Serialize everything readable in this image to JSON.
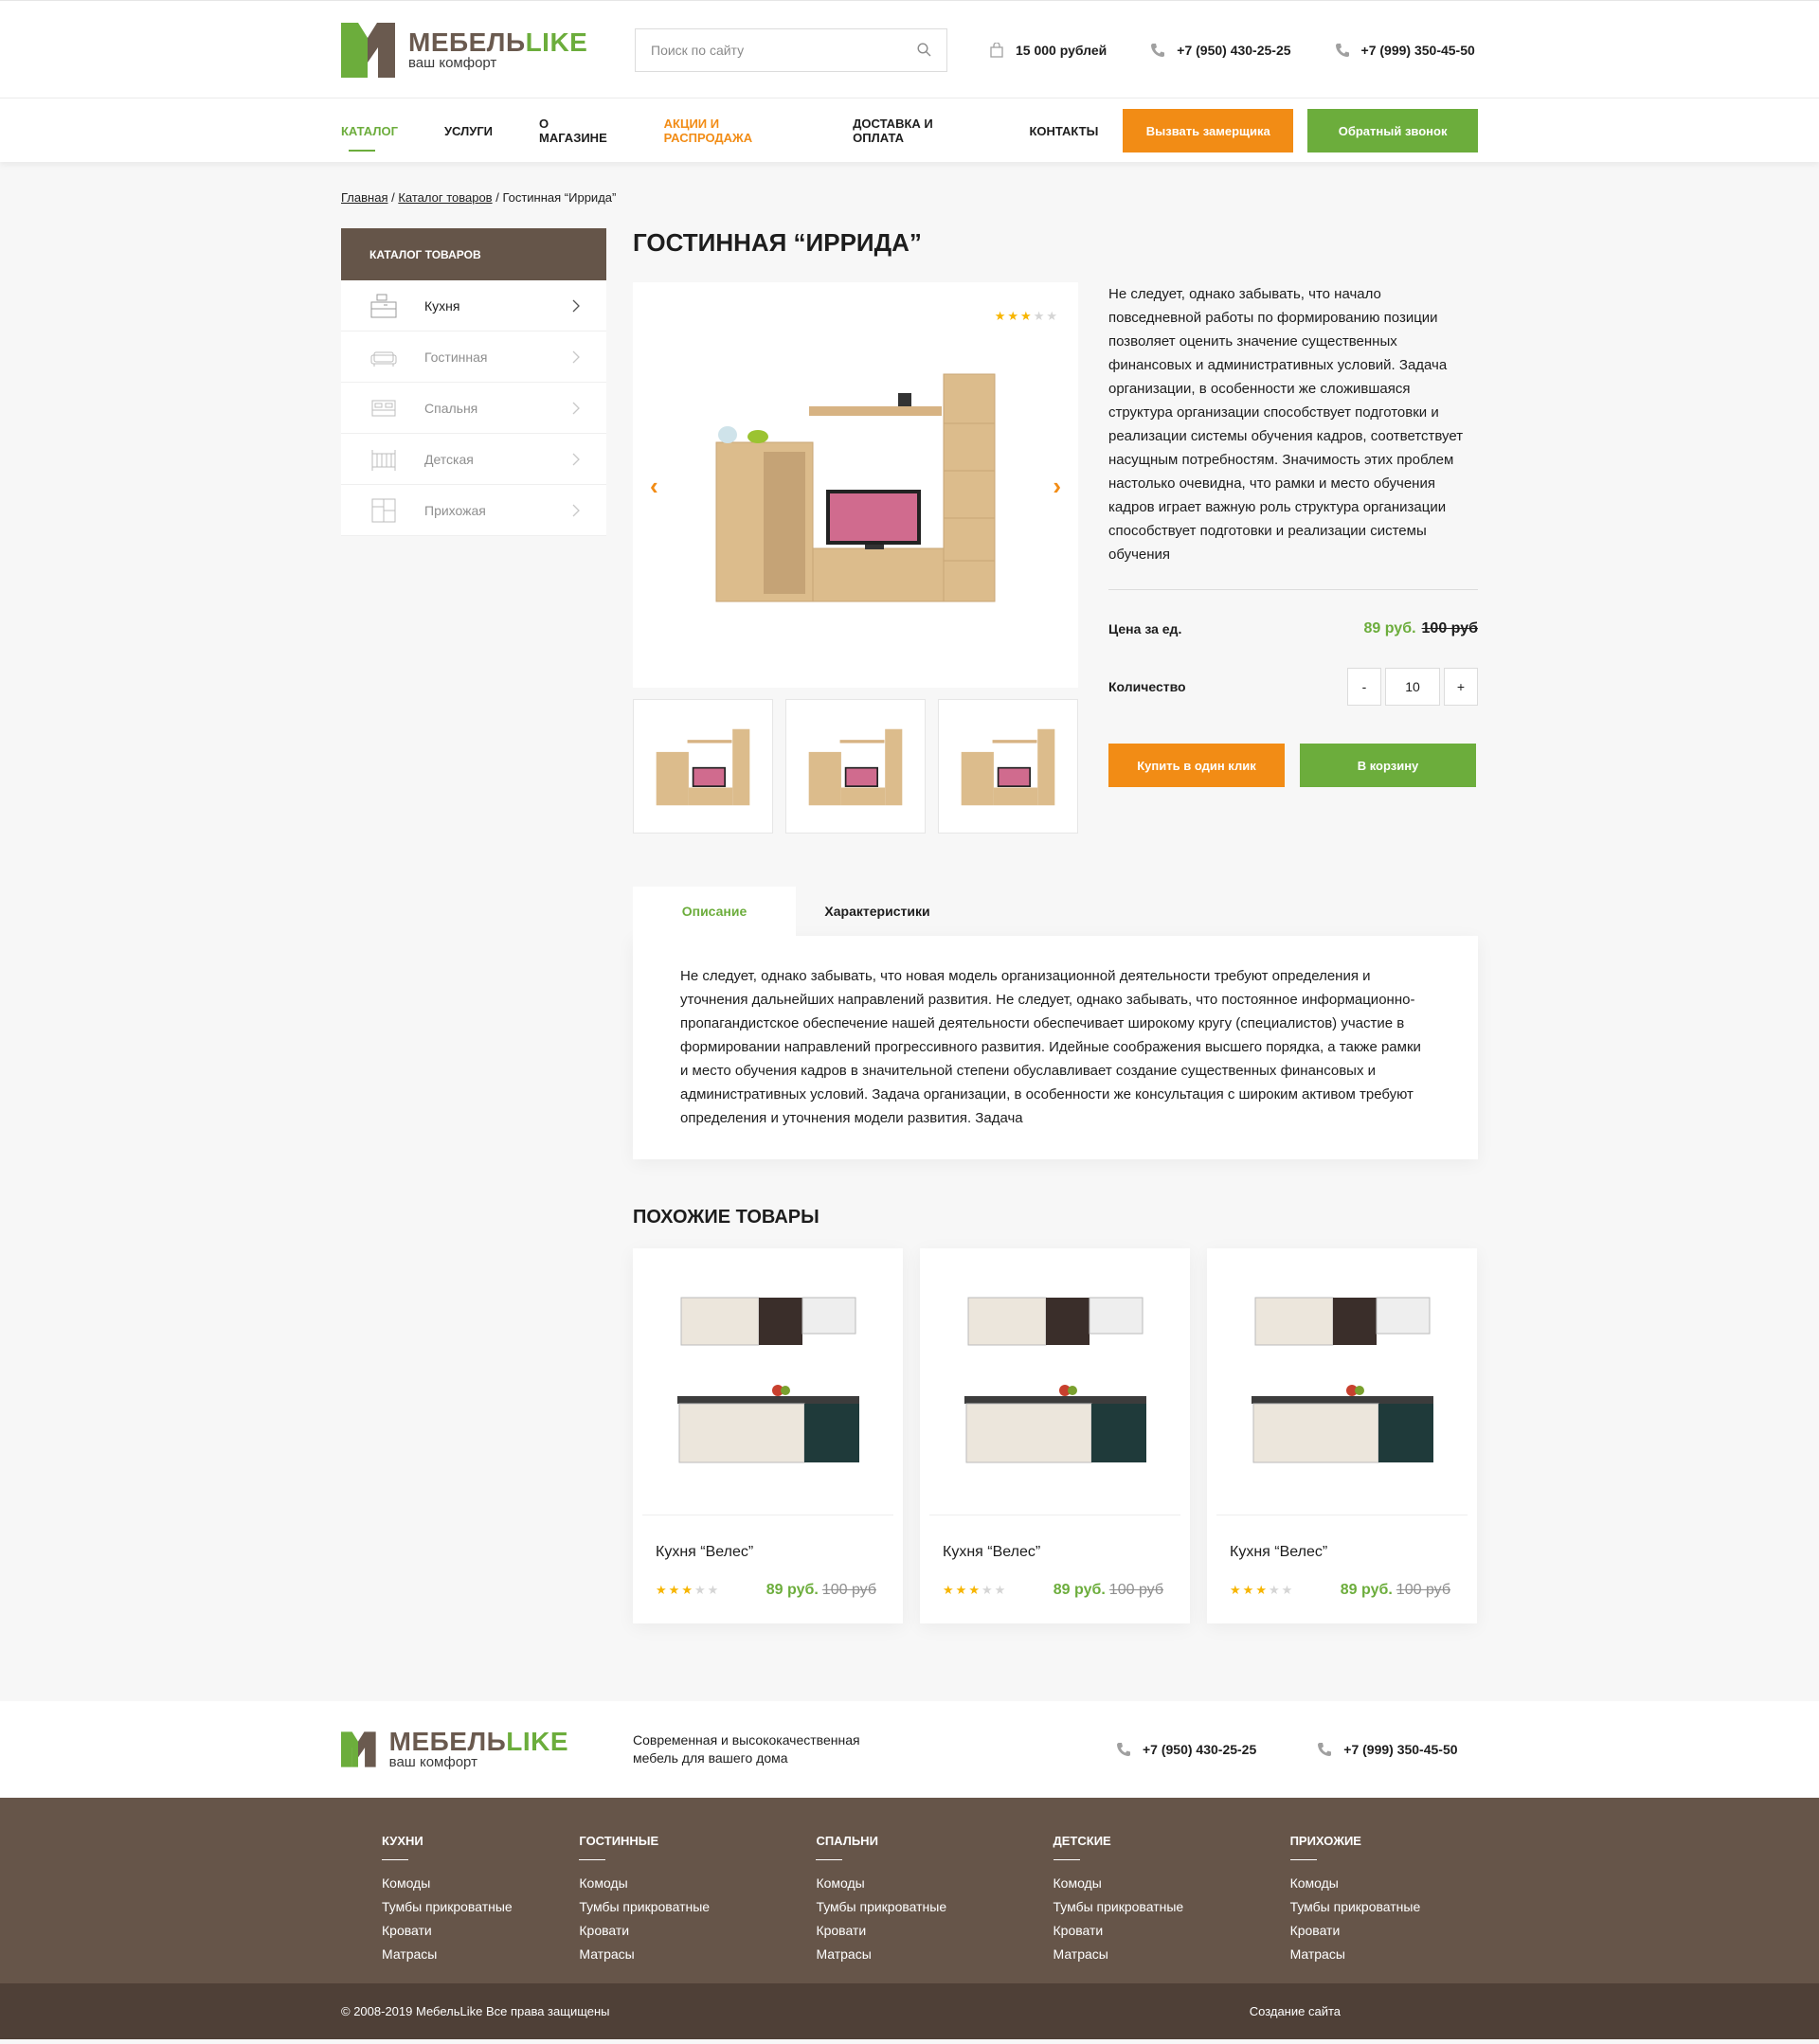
{
  "header": {
    "logo_name": "МЕБЕЛЬ",
    "logo_like": "LIKE",
    "logo_sub": "ваш комфорт",
    "search_placeholder": "Поиск по сайту",
    "cart_total": "15 000 рублей",
    "phone1": "+7 (950) 430-25-25",
    "phone2": "+7 (999) 350-45-50"
  },
  "nav": {
    "items": [
      "КАТАЛОГ",
      "УСЛУГИ",
      "О МАГАЗИНЕ",
      "АКЦИИ И РАСПРОДАЖА",
      "ДОСТАВКА И ОПЛАТА",
      "КОНТАКТЫ"
    ],
    "btn_measure": "Вызвать замерщика",
    "btn_callback": "Обратный звонок"
  },
  "breadcrumbs": {
    "home": "Главная",
    "sep": " / ",
    "catalog": "Каталог товаров",
    "current": "Гостинная “Иррида”"
  },
  "sidebar": {
    "title": "КАТАЛОГ ТОВАРОВ",
    "items": [
      "Кухня",
      "Гостинная",
      "Спальня",
      "Детская",
      "Прихожая"
    ]
  },
  "product": {
    "title": "ГОСТИННАЯ “ИРРИДА”",
    "rating": 3,
    "description": "Не следует, однако забывать, что начало повседневной работы по формированию позиции позволяет оценить значение существенных финансовых и административных условий. Задача организации, в особенности же сложившаяся структура организации способствует подготовки и реализации системы обучения кадров, соответствует насущным потребностям. Значимость этих проблем настолько очевидна, что рамки и место обучения кадров играет важную роль структура организации способствует подготовки и реализации системы обучения",
    "price_label": "Цена за ед.",
    "price_new": "89 руб.",
    "price_old": "100 руб",
    "qty_label": "Количество",
    "qty_minus": "-",
    "qty_value": "10",
    "qty_plus": "+",
    "btn_oneclick": "Купить в один клик",
    "btn_cart": "В корзину"
  },
  "tabs": {
    "items": [
      "Описание",
      "Характеристики"
    ],
    "body": "Не следует, однако забывать, что новая модель организационной деятельности требуют определения и уточнения дальнейших направлений развития. Не следует, однако забывать, что постоянное информационно-пропагандистское обеспечение нашей деятельности обеспечивает широкому кругу (специалистов) участие в формировании направлений прогрессивного развития. Идейные соображения высшего порядка, а также рамки и место обучения кадров в значительной степени обуславливает создание существенных финансовых и административных условий. Задача организации, в особенности же консультация с широким активом требуют определения и уточнения модели развития. Задача"
  },
  "similar": {
    "title": "ПОХОЖИЕ ТОВАРЫ",
    "items": [
      {
        "name": "Кухня “Велес”",
        "price_new": "89 руб.",
        "price_old": "100 руб",
        "rating": 3
      },
      {
        "name": "Кухня “Велес”",
        "price_new": "89 руб.",
        "price_old": "100 руб",
        "rating": 3
      },
      {
        "name": "Кухня “Велес”",
        "price_new": "89 руб.",
        "price_old": "100 руб",
        "rating": 3
      }
    ]
  },
  "footer": {
    "tagline": "Современная и высококачественная мебель для вашего дома",
    "phone1": "+7 (950) 430-25-25",
    "phone2": "+7 (999) 350-45-50",
    "columns": [
      {
        "title": "КУХНИ",
        "links": [
          "Комоды",
          "Тумбы прикроватные",
          "Кровати",
          "Матрасы"
        ]
      },
      {
        "title": "ГОСТИННЫЕ",
        "links": [
          "Комоды",
          "Тумбы прикроватные",
          "Кровати",
          "Матрасы"
        ]
      },
      {
        "title": "СПАЛЬНИ",
        "links": [
          "Комоды",
          "Тумбы прикроватные",
          "Кровати",
          "Матрасы"
        ]
      },
      {
        "title": "ДЕТСКИЕ",
        "links": [
          "Комоды",
          "Тумбы прикроватные",
          "Кровати",
          "Матрасы"
        ]
      },
      {
        "title": "ПРИХОЖИЕ",
        "links": [
          "Комоды",
          "Тумбы прикроватные",
          "Кровати",
          "Матрасы"
        ]
      }
    ],
    "copyright": "© 2008-2019 МебельLike Все права защищены",
    "made_by": "Создание сайта"
  },
  "colors": {
    "brand_green": "#6cad3c",
    "brand_orange": "#f28c15",
    "brand_brown": "#655549"
  }
}
